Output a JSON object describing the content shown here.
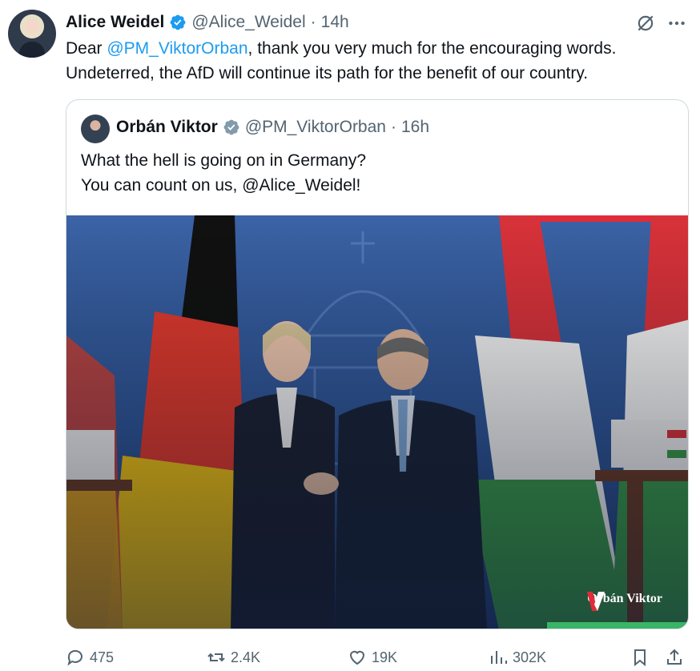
{
  "author": {
    "name": "Alice Weidel",
    "handle": "@Alice_Weidel",
    "separator": "·",
    "time": "14h"
  },
  "tweet": {
    "text_prefix": "Dear ",
    "mention": "@PM_ViktorOrban",
    "text_suffix": ", thank you very much for the encouraging words. Undeterred, the AfD will continue its path for the benefit of our country."
  },
  "quoted": {
    "name": "Orbán Viktor",
    "handle": "@PM_ViktorOrban",
    "separator": "·",
    "time": "16h",
    "line1": "What the hell is going on in Germany?",
    "line2": "You can count on us, @Alice_Weidel!",
    "watermark": "Orbán Viktor"
  },
  "actions": {
    "replies": "475",
    "reposts": "2.4K",
    "likes": "19K",
    "views": "302K"
  },
  "icons": [
    "verified-badge-icon",
    "grok-icon",
    "more-icon",
    "reply-icon",
    "repost-icon",
    "like-icon",
    "views-icon",
    "bookmark-icon",
    "share-icon"
  ],
  "colors": {
    "accent": "#1d9bf0",
    "muted": "#536471",
    "text": "#0f1419",
    "border": "#cfd9de",
    "verified_blue": "#1d9bf0",
    "verified_gray": "#829aab"
  }
}
